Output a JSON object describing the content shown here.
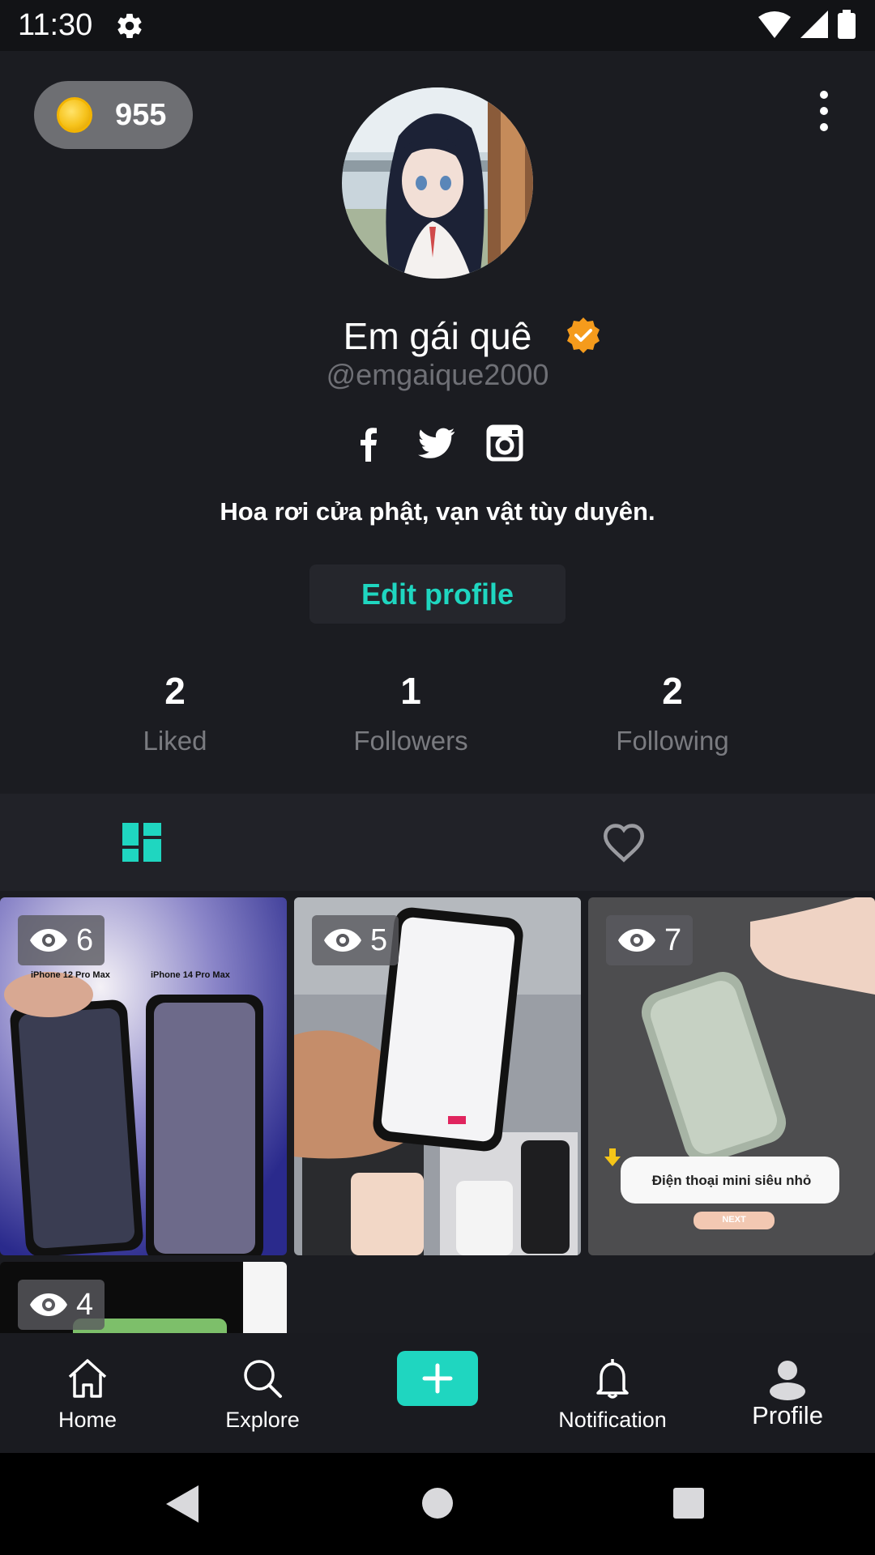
{
  "status_bar": {
    "time": "11:30"
  },
  "header": {
    "coins": "955"
  },
  "profile": {
    "name": "Em gái quê",
    "handle": "@emgaique2000",
    "bio": "Hoa rơi cửa phật, vạn vật tùy duyên.",
    "edit_label": "Edit profile"
  },
  "stats": [
    {
      "value": "2",
      "label": "Liked"
    },
    {
      "value": "1",
      "label": "Followers"
    },
    {
      "value": "2",
      "label": "Following"
    }
  ],
  "tabs": [
    {
      "icon": "grid-icon",
      "active": true
    },
    {
      "icon": "heart-icon",
      "active": false
    }
  ],
  "videos": [
    {
      "views": "6",
      "overlay_texts": [
        "iPhone 12 Pro Max",
        "iPhone 14 Pro Max"
      ]
    },
    {
      "views": "5"
    },
    {
      "views": "7",
      "overlay_texts": [
        "Điện thoại mini siêu nhỏ",
        "NEXT"
      ]
    },
    {
      "views": "4"
    }
  ],
  "bottom_nav": [
    {
      "label": "Home",
      "icon": "home-icon"
    },
    {
      "label": "Explore",
      "icon": "search-icon"
    },
    {
      "label": "",
      "icon": "plus-icon"
    },
    {
      "label": "Notification",
      "icon": "bell-icon"
    },
    {
      "label": "Profile",
      "icon": "person-icon"
    }
  ],
  "colors": {
    "accent": "#1fd6c0",
    "background": "#1b1c21",
    "verified": "#f59b1c"
  }
}
